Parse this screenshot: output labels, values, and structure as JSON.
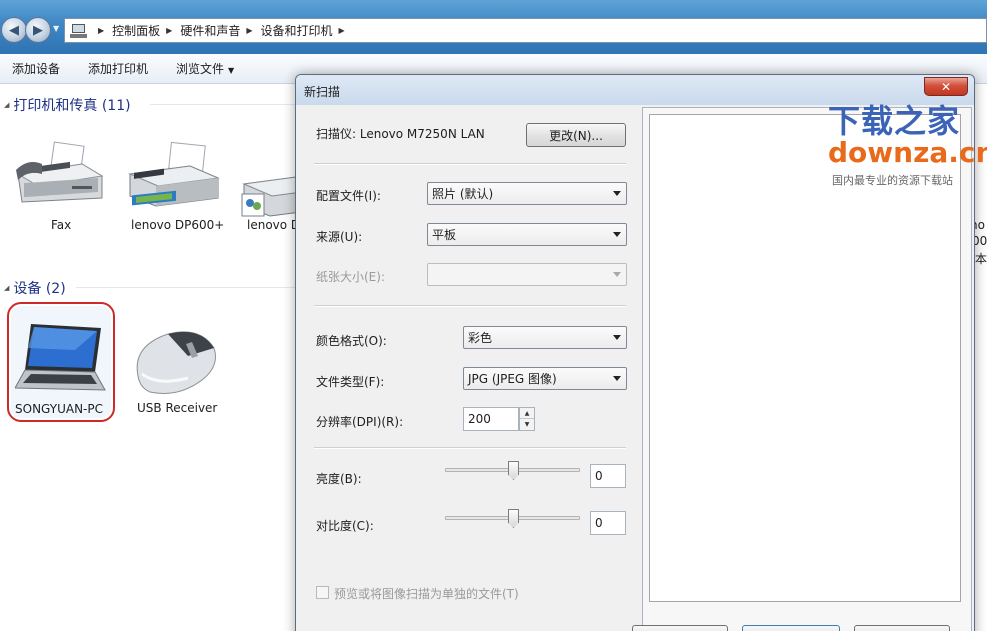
{
  "explorer": {
    "breadcrumbs": [
      "控制面板",
      "硬件和声音",
      "设备和打印机"
    ],
    "toolbar": {
      "add_device": "添加设备",
      "add_printer": "添加打印机",
      "browse_files": "浏览文件"
    },
    "groups": {
      "printers_header": "打印机和传真 (11)",
      "devices_header": "设备 (2)"
    },
    "printers": [
      {
        "label": "Fax"
      },
      {
        "label": "lenovo DP600+"
      },
      {
        "label": "lenovo D"
      }
    ],
    "devices": [
      {
        "label": "SONGYUAN-PC"
      },
      {
        "label": "USB Receiver"
      }
    ],
    "right_edge_label_fragments": [
      "no",
      "00",
      "本"
    ]
  },
  "scan_dialog": {
    "title": "新扫描",
    "close_label": "✕",
    "scanner_label": "扫描仪: Lenovo M7250N LAN",
    "change_button": "更改(N)...",
    "profile": {
      "label": "配置文件(I):",
      "value": "照片 (默认)"
    },
    "source": {
      "label": "来源(U):",
      "value": "平板"
    },
    "paper_size": {
      "label": "纸张大小(E):",
      "value": ""
    },
    "color_format": {
      "label": "颜色格式(O):",
      "value": "彩色"
    },
    "file_type": {
      "label": "文件类型(F):",
      "value": "JPG (JPEG 图像)"
    },
    "resolution": {
      "label": "分辨率(DPI)(R):",
      "value": "200"
    },
    "brightness": {
      "label": "亮度(B):",
      "value": "0",
      "level": 0
    },
    "contrast": {
      "label": "对比度(C):",
      "value": "0",
      "level": 0
    },
    "separate_files_checkbox": {
      "label": "预览或将图像扫描为单独的文件(T)",
      "checked": false
    }
  },
  "watermark": {
    "line1": "下载之家",
    "line2": "downza.cn",
    "line3": "国内最专业的资源下载站"
  }
}
